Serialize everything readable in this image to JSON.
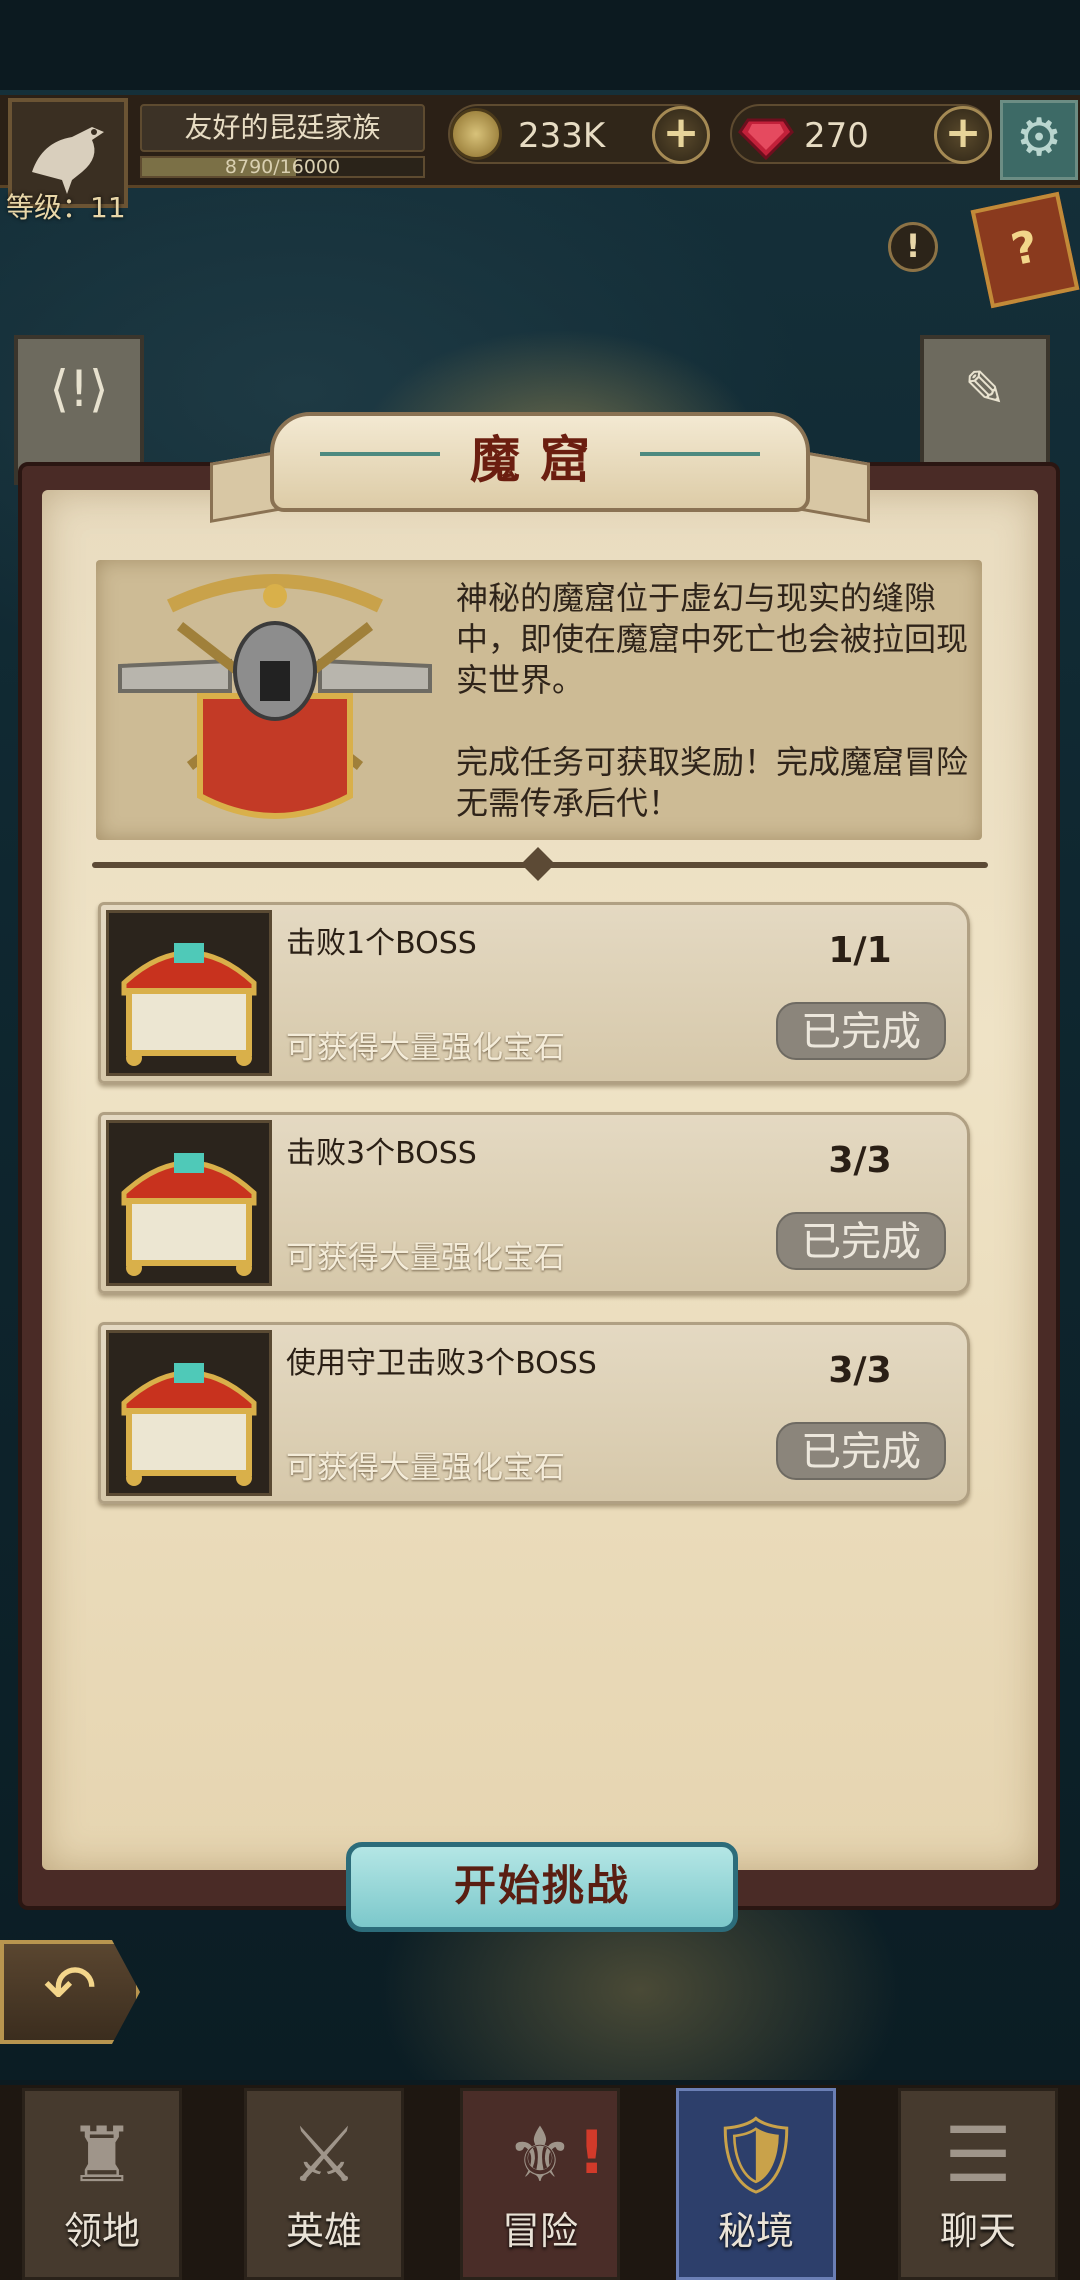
{
  "topbar": {
    "level_label": "等级：11",
    "clan_name": "友好的昆廷家族",
    "xp_text": "8790/16000",
    "xp_fraction": 0.549,
    "gold": "233K",
    "gems": "270",
    "plus_symbol": "+",
    "alert_symbol": "!",
    "book_symbol": "?"
  },
  "dialog": {
    "title": "魔窟",
    "description_1": "神秘的魔窟位于虚幻与现实的缝隙中，即使在魔窟中死亡也会被拉回现实世界。",
    "description_2": "完成任务可获取奖励！完成魔窟冒险无需传承后代！",
    "tasks": [
      {
        "title": "击败1个BOSS",
        "reward": "可获得大量强化宝石",
        "progress": "1/1",
        "status": "已完成"
      },
      {
        "title": "击败3个BOSS",
        "reward": "可获得大量强化宝石",
        "progress": "3/3",
        "status": "已完成"
      },
      {
        "title": "使用守卫击败3个BOSS",
        "reward": "可获得大量强化宝石",
        "progress": "3/3",
        "status": "已完成"
      }
    ],
    "start_button": "开始挑战"
  },
  "nav": {
    "tabs": [
      {
        "label": "领地",
        "icon": "castle-icon"
      },
      {
        "label": "英雄",
        "icon": "helmet-swords-icon"
      },
      {
        "label": "冒险",
        "icon": "sword-wings-icon"
      },
      {
        "label": "秘境",
        "icon": "secret-realm-icon"
      },
      {
        "label": "聊天",
        "icon": "chat-icon"
      }
    ],
    "active_index": 3,
    "badge_symbol": "!"
  },
  "colors": {
    "panel_frame": "#4a2b26",
    "parchment": "#efe3c6",
    "title_red": "#6b1e10",
    "button_teal": "#7cc8cb",
    "completed_badge": "#8b857b"
  }
}
